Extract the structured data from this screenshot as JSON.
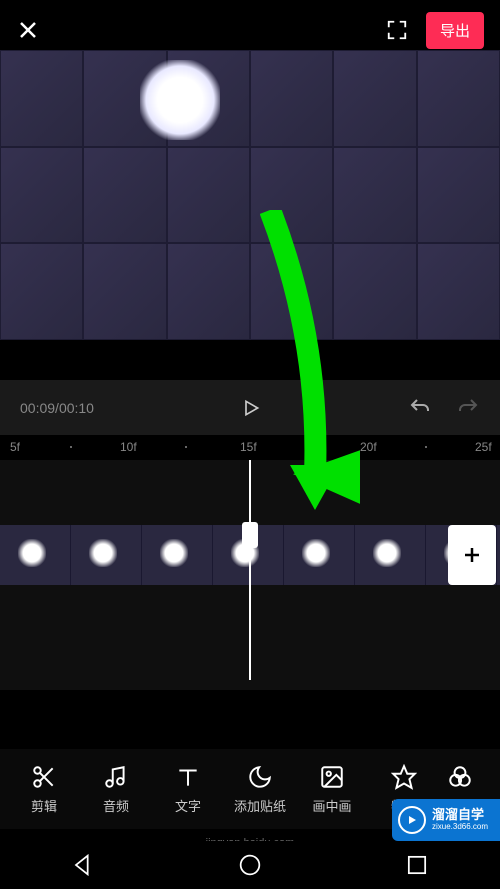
{
  "header": {
    "export_label": "导出"
  },
  "playback": {
    "current_time": "00:09",
    "total_time": "00:10"
  },
  "ruler": {
    "marks": [
      "5f",
      "10f",
      "15f",
      "20f",
      "25f"
    ]
  },
  "toolbar": {
    "items": [
      {
        "name": "trim",
        "label": "剪辑",
        "icon": "scissors-icon"
      },
      {
        "name": "audio",
        "label": "音频",
        "icon": "music-note-icon"
      },
      {
        "name": "text",
        "label": "文字",
        "icon": "text-icon"
      },
      {
        "name": "sticker",
        "label": "添加贴纸",
        "icon": "moon-icon"
      },
      {
        "name": "pip",
        "label": "画中画",
        "icon": "picture-icon"
      },
      {
        "name": "effect",
        "label": "特效",
        "icon": "star-icon"
      },
      {
        "name": "filter",
        "label": "滤",
        "icon": "filter-icon"
      }
    ]
  },
  "watermark": {
    "title": "溜溜自学",
    "url": "zixue.3d66.com"
  },
  "footer_source": "jingyan.baidu.com",
  "colors": {
    "accent": "#fe2c55",
    "annotation": "#00e000",
    "watermark_bg": "#0b74d1"
  }
}
